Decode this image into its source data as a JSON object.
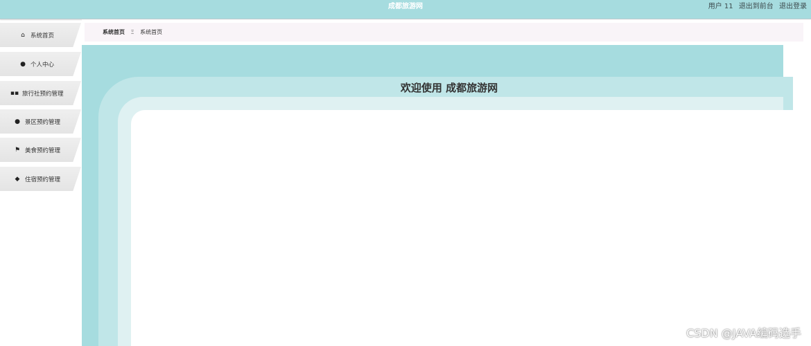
{
  "header": {
    "title": "成都旅游网",
    "user_label": "用户 11",
    "back_front_label": "退出到前台",
    "logout_label": "退出登录"
  },
  "sidebar": {
    "items": [
      {
        "label": "系统首页",
        "icon": "home-icon"
      },
      {
        "label": "个人中心",
        "icon": "user-icon"
      },
      {
        "label": "旅行社预约管理",
        "icon": "grid-icon"
      },
      {
        "label": "景区预约管理",
        "icon": "user-icon"
      },
      {
        "label": "美食预约管理",
        "icon": "flag-icon"
      },
      {
        "label": "住宿预约管理",
        "icon": "pin-icon"
      }
    ]
  },
  "breadcrumb": {
    "home": "系统首页",
    "separator": "Ξ",
    "current": "系统首页"
  },
  "main": {
    "welcome": "欢迎使用 成都旅游网"
  },
  "watermark": "CSDN @JAVA编码选手",
  "colors": {
    "accent": "#a6dcdf",
    "band_mid": "#c0e6e8",
    "band_light": "#dff1f2",
    "breadcrumb_bg": "#f9f4f8"
  }
}
